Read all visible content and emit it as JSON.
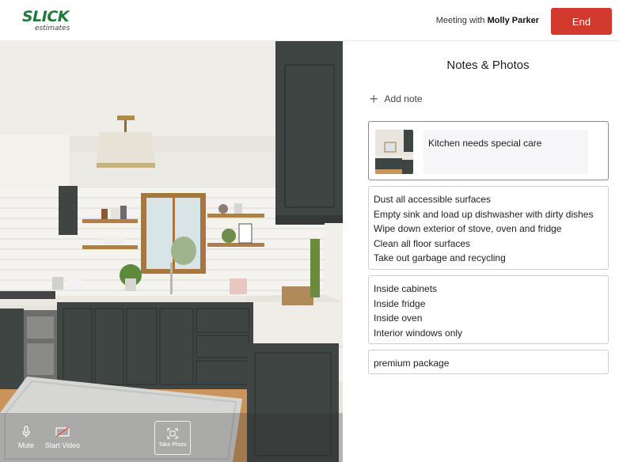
{
  "header": {
    "logo_main": "SLICK",
    "logo_sub": "estimates",
    "meeting_prefix": "Meeting with",
    "meeting_name": "Molly Parker",
    "end_label": "End"
  },
  "video": {
    "controls": {
      "mute_label": "Mute",
      "start_video_label": "Start Video",
      "take_photo_label": "Take Photo"
    }
  },
  "panel": {
    "title": "Notes & Photos",
    "add_note_label": "Add note",
    "photo_note": "Kitchen needs special care",
    "notes": [
      {
        "lines": [
          "Dust all accessible surfaces",
          "Empty sink and load up dishwasher with dirty dishes",
          "Wipe down exterior of stove, oven and fridge",
          "Clean all floor surfaces",
          "Take out garbage and recycling"
        ]
      },
      {
        "lines": [
          "Inside cabinets",
          "Inside fridge",
          "Inside oven",
          "Interior windows only"
        ]
      },
      {
        "lines": [
          "premium package"
        ]
      }
    ]
  },
  "colors": {
    "brand_green": "#1e7a3a",
    "end_red": "#d23a2e",
    "cabinet": "#3f4543"
  }
}
